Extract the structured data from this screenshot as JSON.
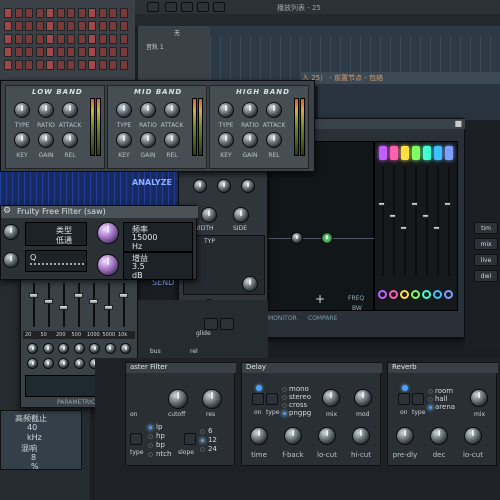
{
  "topbar": {
    "pattern_label": "播放列表 - 25"
  },
  "channel_rack": {
    "label": "音轨 1",
    "item2": "无"
  },
  "playlist": {
    "track_title": "入 25） - 前置节点 - 包络"
  },
  "eq_plugin": {
    "bands": [
      "LOW BAND",
      "MID BAND",
      "HIGH BAND"
    ],
    "knob_labels_top": [
      "TYPE",
      "RATIO",
      "ATTACK",
      "TYPE",
      "RATIO",
      "ATTACK",
      "TYPE",
      "RATIO",
      "ATTACK"
    ],
    "knob_labels_bottom": [
      "KEY",
      "GAIN",
      "REL",
      "KEY",
      "GAIN",
      "REL",
      "KEY",
      "GAIN",
      "REL"
    ],
    "analyze_label": "ANALYZE",
    "send_label": "SEND"
  },
  "fruity_filter": {
    "title": "Fruity Free Filter (saw)",
    "type_label": "类型",
    "type_value": "低通",
    "freq_label": "频率",
    "freq_value": "15000",
    "freq_unit": "Hz",
    "q_label": "Q",
    "gain_label": "增益",
    "gain_value": "3.5",
    "gain_unit": "dB"
  },
  "parametric_eq": {
    "band_freqs": [
      "20",
      "50",
      "200",
      "500",
      "1000",
      "5000",
      "10k"
    ],
    "name": "PARAMETRIC"
  },
  "left_panel": {
    "label1": "高频截止",
    "value1": "40",
    "unit1": "kHz",
    "label2": "混响",
    "value2": "8",
    "unit2": "%"
  },
  "mid_knobs": {
    "labels": [
      "WIDTH",
      "SIDE",
      "GAIN",
      "MIX",
      "DRY",
      "WET"
    ],
    "section": "TYP"
  },
  "eq_display": {
    "monitor_label": "MONITOR",
    "compare_label": "COMPARE",
    "freq_label": "FREQ",
    "bw_label": "BW",
    "band_colors": [
      "#c060ff",
      "#ff60b0",
      "#ffe040",
      "#80ff60",
      "#40ffd0",
      "#40c0ff",
      "#80a0ff"
    ]
  },
  "side_buttons": [
    "tim",
    "mix",
    "live",
    "dwl"
  ],
  "bottom_labels": [
    "bus",
    "rel",
    "glide"
  ],
  "master_filter": {
    "title": "aster Filter",
    "knob_labels": [
      "on",
      "cutoff",
      "res"
    ],
    "type_label": "type",
    "types": [
      "lp",
      "hp",
      "bp",
      "ntch"
    ],
    "slope_label": "slope",
    "slopes": [
      "6",
      "12",
      "24"
    ]
  },
  "delay": {
    "title": "Delay",
    "on_label": "on",
    "type_label": "type",
    "types": [
      "mono",
      "stereo",
      "cross",
      "pngpg"
    ],
    "top_knobs": [
      "mix",
      "mod"
    ],
    "bottom_knobs": [
      "time",
      "f-back",
      "lo-cut",
      "hi-cut"
    ]
  },
  "reverb": {
    "title": "Reverb",
    "on_label": "on",
    "type_label": "type",
    "types": [
      "room",
      "hall",
      "arena"
    ],
    "top_knobs": [
      "mix"
    ],
    "bottom_knobs": [
      "pre-dly",
      "dec",
      "lo-cut"
    ]
  }
}
